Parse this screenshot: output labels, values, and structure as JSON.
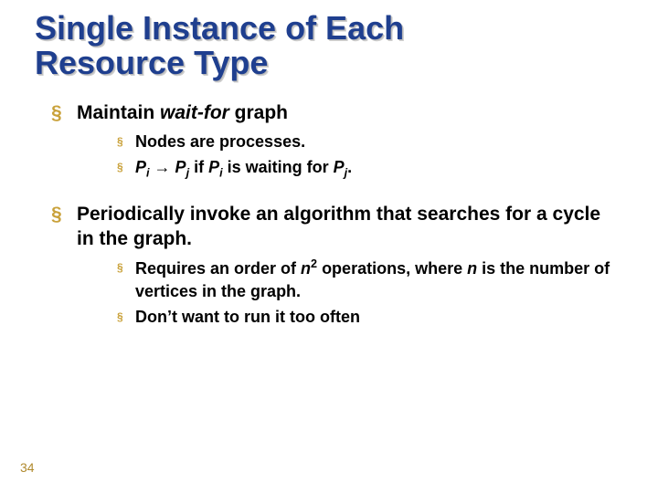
{
  "title_line1": "Single Instance of Each",
  "title_line2": "Resource Type",
  "bullets": [
    {
      "text_prefix": "Maintain ",
      "text_italic": "wait-for",
      "text_suffix": " graph",
      "sub": [
        {
          "kind": "plain",
          "text": "Nodes are processes."
        },
        {
          "kind": "formula",
          "p1_base": "P",
          "p1_sub": "i",
          "arrow": "→",
          "p2_base": "P",
          "p2_sub": "j",
          "mid": " if ",
          "p3_base": "P",
          "p3_sub": "i",
          "mid2": " is waiting for ",
          "p4_base": "P",
          "p4_sub": "j",
          "end": "."
        }
      ]
    },
    {
      "text": "Periodically invoke an algorithm that searches for a cycle in the graph.",
      "sub": [
        {
          "kind": "complexity",
          "pre": "Requires an order of ",
          "n": "n",
          "exp": "2",
          "mid": " operations, where ",
          "n2": "n",
          "post": " is the number of vertices in the graph."
        },
        {
          "kind": "plain",
          "text": "Don’t want to run it too often"
        }
      ]
    }
  ],
  "page_number": "34"
}
